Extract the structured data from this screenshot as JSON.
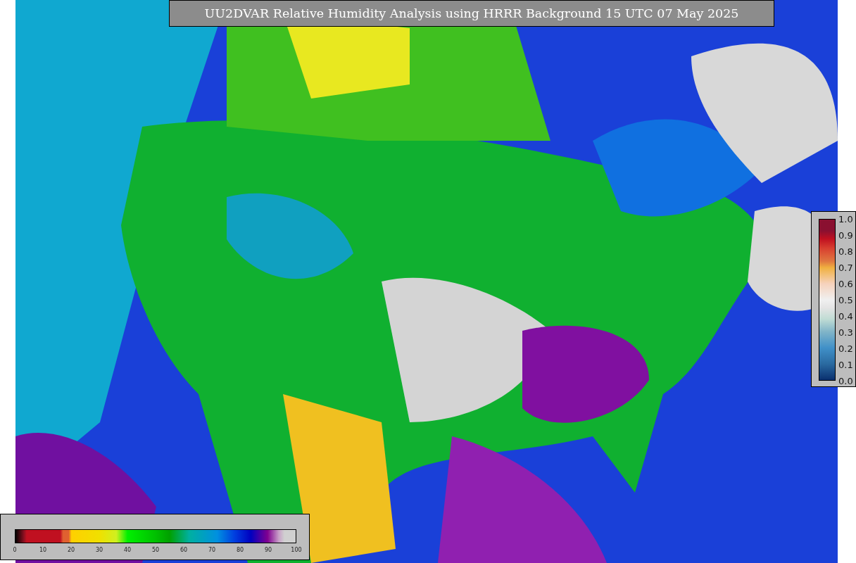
{
  "title": "UU2DVAR Relative Humidity Analysis using HRRR Background 15 UTC 07 May 2025",
  "humidity_colorbar": {
    "ticks": [
      "0",
      "10",
      "20",
      "30",
      "40",
      "50",
      "60",
      "70",
      "80",
      "90",
      "100"
    ]
  },
  "observation_colorbar": {
    "ticks": [
      "1.0",
      "0.9",
      "0.8",
      "0.7",
      "0.6",
      "0.5",
      "0.4",
      "0.3",
      "0.2",
      "0.1",
      "0.0"
    ]
  }
}
